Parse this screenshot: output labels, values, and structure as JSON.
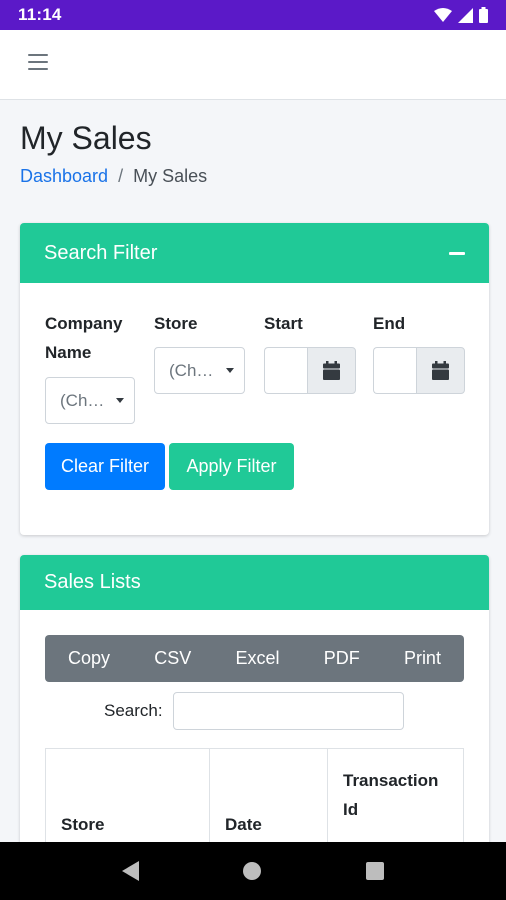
{
  "status_bar": {
    "time": "11:14",
    "icons": [
      "wifi-icon",
      "signal-icon",
      "battery-icon"
    ]
  },
  "page": {
    "title": "My Sales"
  },
  "breadcrumb": {
    "home": "Dashboard",
    "separator": "/",
    "current": "My Sales"
  },
  "search_filter": {
    "title": "Search Filter",
    "company_label": "Company Name",
    "company_placeholder": "(Ch…",
    "store_label": "Store",
    "store_placeholder": "(Ch…",
    "start_label": "Start",
    "end_label": "End",
    "clear_button": "Clear Filter",
    "apply_button": "Apply Filter"
  },
  "sales_list": {
    "title": "Sales Lists",
    "export_buttons": [
      "Copy",
      "CSV",
      "Excel",
      "PDF",
      "Print"
    ],
    "search_label": "Search:",
    "search_value": "",
    "columns": [
      "Store",
      "Date",
      "Transaction Id"
    ]
  },
  "colors": {
    "status_bar": "#5b19c8",
    "accent_green": "#20c997",
    "primary_blue": "#007bff",
    "export_gray": "#6c757d"
  }
}
